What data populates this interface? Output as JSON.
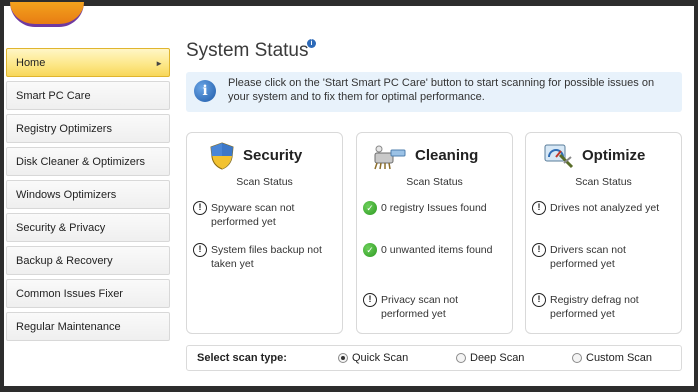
{
  "sidebar": {
    "items": [
      {
        "label": "Home",
        "active": true
      },
      {
        "label": "Smart PC Care"
      },
      {
        "label": "Registry Optimizers"
      },
      {
        "label": "Disk Cleaner & Optimizers"
      },
      {
        "label": "Windows Optimizers"
      },
      {
        "label": "Security & Privacy"
      },
      {
        "label": "Backup & Recovery"
      },
      {
        "label": "Common Issues Fixer"
      },
      {
        "label": "Regular Maintenance"
      }
    ]
  },
  "main": {
    "title": "System Status",
    "info_glyph": "i",
    "banner_text": "Please click on the 'Start Smart PC Care' button to start scanning for possible issues on your system and to fix them for optimal performance."
  },
  "cards": [
    {
      "title": "Security",
      "subtitle": "Scan Status",
      "icon": "shield-icon",
      "items": [
        {
          "status": "warning",
          "text": "Spyware scan not performed yet"
        },
        {
          "status": "warning",
          "text": "System files backup not taken yet"
        }
      ]
    },
    {
      "title": "Cleaning",
      "subtitle": "Scan Status",
      "icon": "broom-icon",
      "items": [
        {
          "status": "ok",
          "text": "0 registry Issues found"
        },
        {
          "status": "ok",
          "text": "0 unwanted items found"
        },
        {
          "status": "warning",
          "text": "Privacy scan not performed yet"
        }
      ]
    },
    {
      "title": "Optimize",
      "subtitle": "Scan Status",
      "icon": "speedometer-icon",
      "items": [
        {
          "status": "warning",
          "text": "Drives not analyzed yet"
        },
        {
          "status": "warning",
          "text": "Drivers scan not performed yet"
        },
        {
          "status": "warning",
          "text": "Registry defrag not performed yet"
        }
      ]
    }
  ],
  "scan_type": {
    "label": "Select scan type:",
    "options": [
      {
        "label": "Quick Scan",
        "selected": true
      },
      {
        "label": "Deep Scan",
        "selected": false
      },
      {
        "label": "Custom Scan",
        "selected": false
      }
    ]
  },
  "glyphs": {
    "warning": "!",
    "ok": "✓",
    "arrow": "►"
  }
}
